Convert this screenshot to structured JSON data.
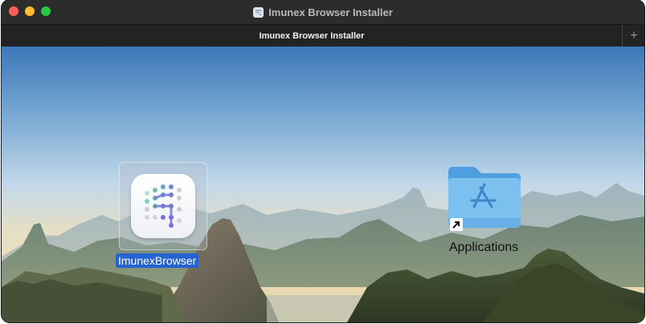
{
  "window": {
    "title": "Imunex Browser Installer",
    "tab_label": "Imunex Browser Installer",
    "new_tab_symbol": "+"
  },
  "items": {
    "app": {
      "label": "ImunexBrowser",
      "icon": "imunex-browser-app-icon",
      "selected": true
    },
    "folder": {
      "label": "Applications",
      "icon": "applications-folder-icon",
      "alias": true
    }
  },
  "colors": {
    "selection": "#2463d1",
    "folder": "#6cb4ea",
    "close": "#fe5f57",
    "minimize": "#febc2e",
    "maximize": "#28c840"
  }
}
